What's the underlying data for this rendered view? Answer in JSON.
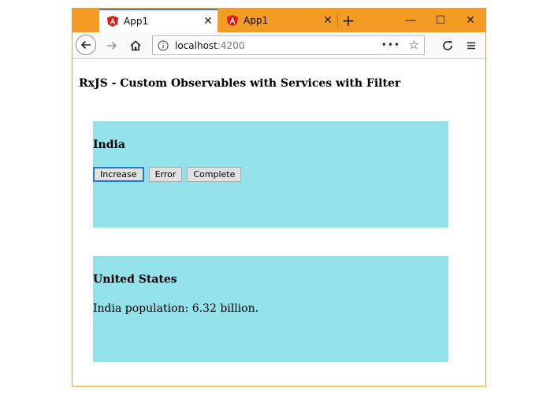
{
  "browser": {
    "tabs": [
      {
        "label": "App1",
        "active": true
      },
      {
        "label": "App1",
        "active": false
      }
    ],
    "url_host": "localhost",
    "url_port": ":4200",
    "accent": "#f39c25"
  },
  "page": {
    "title": "RxJS - Custom Observables with Services with Filter"
  },
  "panels": [
    {
      "heading": "India",
      "buttons": [
        "Increase",
        "Error",
        "Complete"
      ]
    },
    {
      "heading": "United States",
      "message": "India population: 6.32 billion."
    }
  ],
  "colors": {
    "panel_bg": "#93e1e9"
  }
}
